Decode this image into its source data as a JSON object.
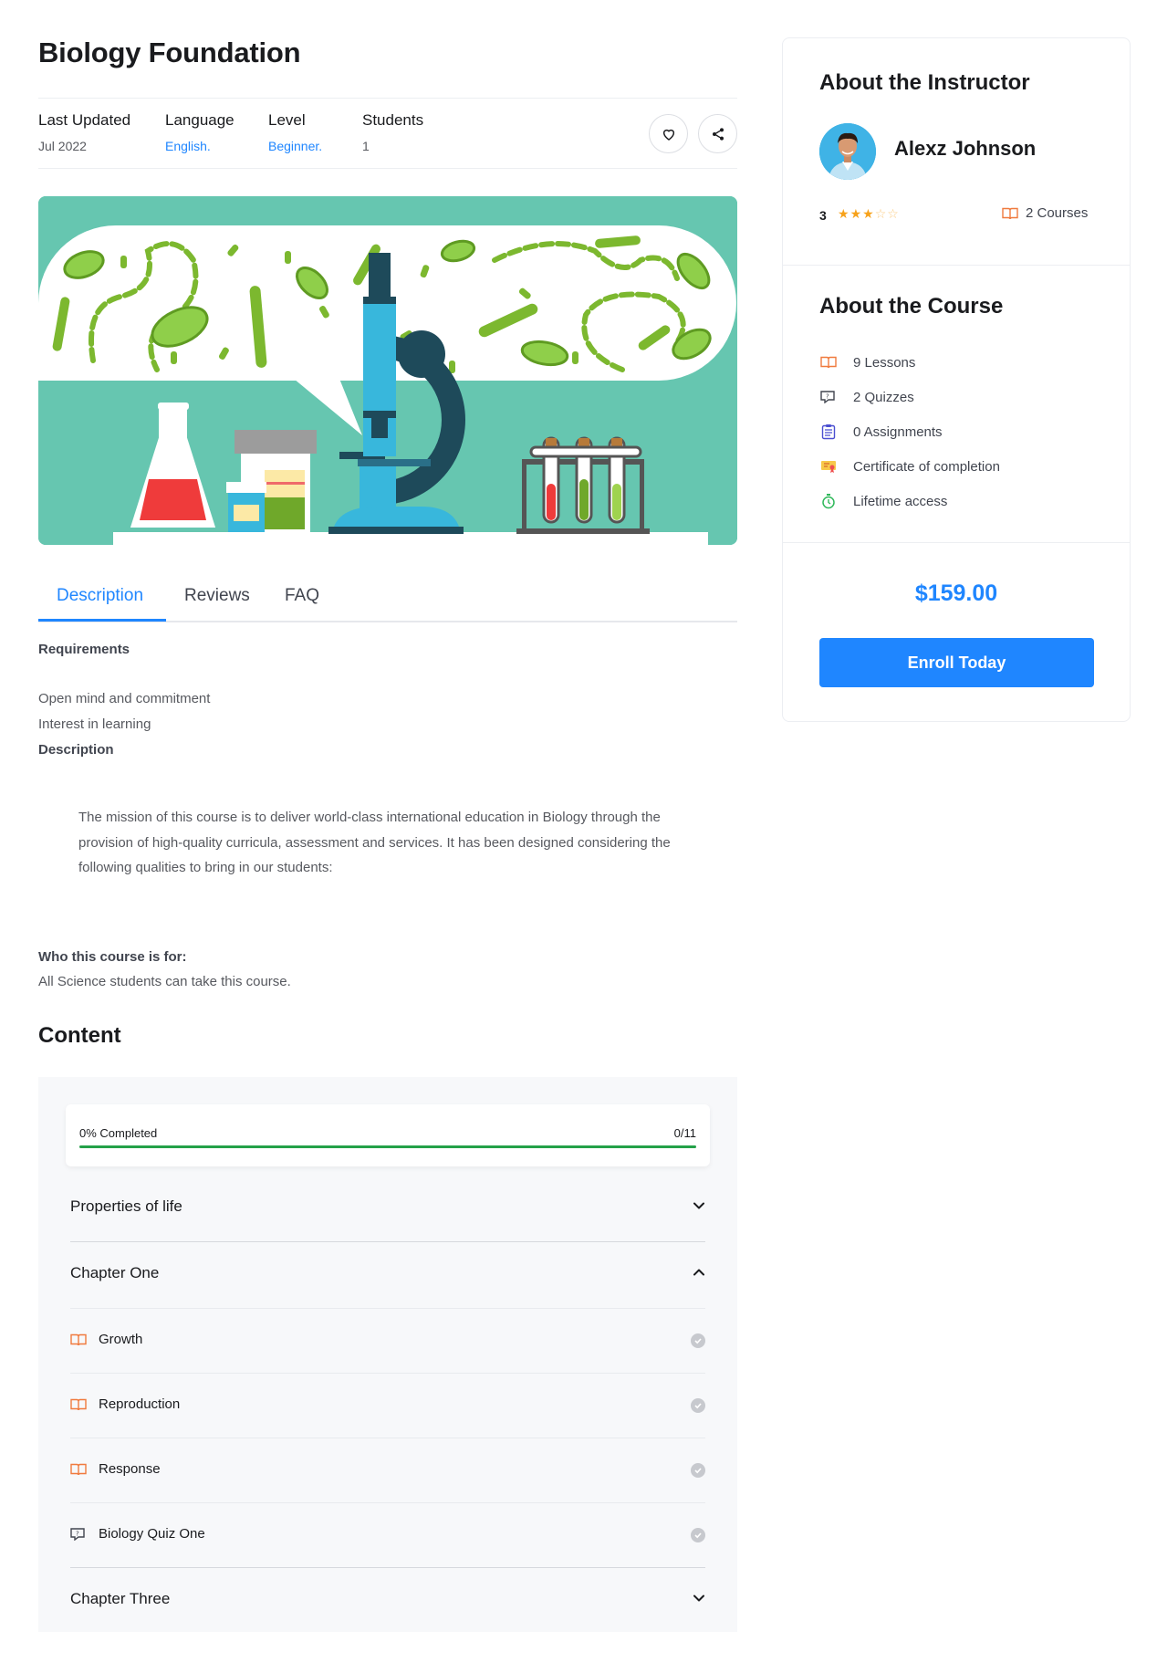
{
  "course": {
    "title": "Biology Foundation"
  },
  "meta": {
    "last_updated_label": "Last Updated",
    "last_updated_value": "Jul 2022",
    "language_label": "Language",
    "language_value": "English.",
    "level_label": "Level",
    "level_value": "Beginner.",
    "students_label": "Students",
    "students_value": "1",
    "wishlist_icon": "heart-icon",
    "share_icon": "share-icon"
  },
  "tabs": [
    {
      "label": "Description",
      "active": true
    },
    {
      "label": "Reviews",
      "active": false
    },
    {
      "label": "FAQ",
      "active": false
    }
  ],
  "description": {
    "requirements_heading": "Requirements",
    "requirements": [
      "Open mind and commitment",
      "Interest in learning"
    ],
    "description_heading": "Description",
    "paragraph": "The mission of this course is to deliver world-class international education in Biology through the provision of high-quality curricula, assessment and services. It has been designed considering the following qualities to bring in our students:",
    "who_heading": "Who this course is for:",
    "who_text": "All Science students can take this course."
  },
  "content": {
    "heading": "Content",
    "progress_label": "0% Completed",
    "progress_count": "0/11",
    "progress_fraction": 0.0,
    "topics": [
      {
        "title": "Properties of life",
        "expanded": false
      },
      {
        "title": "Chapter One",
        "expanded": true
      },
      {
        "title": "Chapter Three",
        "expanded": false
      }
    ],
    "lessons": [
      {
        "title": "Growth",
        "icon": "book-icon"
      },
      {
        "title": "Reproduction",
        "icon": "book-icon"
      },
      {
        "title": "Response",
        "icon": "book-icon"
      },
      {
        "title": "Biology Quiz One",
        "icon": "quiz-icon"
      }
    ]
  },
  "sidebar": {
    "instructor_heading": "About the Instructor",
    "instructor_name": "Alexz Johnson",
    "rating_value": "3",
    "rating_stars": 3,
    "rating_max": 5,
    "courses_count": "2 Courses",
    "course_heading": "About the Course",
    "features": [
      {
        "label": "9 Lessons",
        "icon": "book-icon"
      },
      {
        "label": "2 Quizzes",
        "icon": "quiz-icon"
      },
      {
        "label": "0 Assignments",
        "icon": "assignment-icon"
      },
      {
        "label": "Certificate of completion",
        "icon": "certificate-icon"
      },
      {
        "label": "Lifetime access",
        "icon": "stopwatch-icon"
      }
    ],
    "price": "$159.00",
    "enroll_label": "Enroll Today"
  },
  "colors": {
    "accent": "#1f86ff",
    "progress": "#24a148",
    "hero_background": "#66c6b0",
    "book_icon": "#f07a3e",
    "star": "#f7a21b"
  }
}
